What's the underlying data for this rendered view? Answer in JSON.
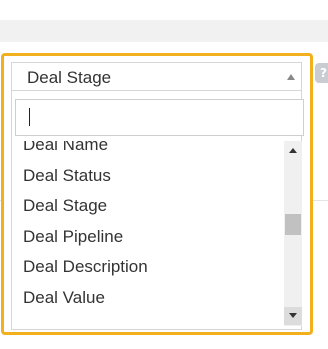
{
  "dropdown": {
    "selected_label": "Deal Stage",
    "search": {
      "value": "",
      "placeholder": ""
    },
    "options": [
      "Deal Name",
      "Deal Status",
      "Deal Stage",
      "Deal Pipeline",
      "Deal Description",
      "Deal Value"
    ]
  },
  "help_icon": {
    "glyph": "?"
  },
  "colors": {
    "focus_border": "#f2b01e",
    "text": "#333333",
    "scrollbar_track": "#f0f0f0",
    "scrollbar_thumb": "#c1c1c1"
  },
  "icons": {
    "caret": "caret-up-icon",
    "scroll_up": "scroll-up-arrow-icon",
    "scroll_down": "scroll-down-arrow-icon",
    "help": "help-icon"
  }
}
